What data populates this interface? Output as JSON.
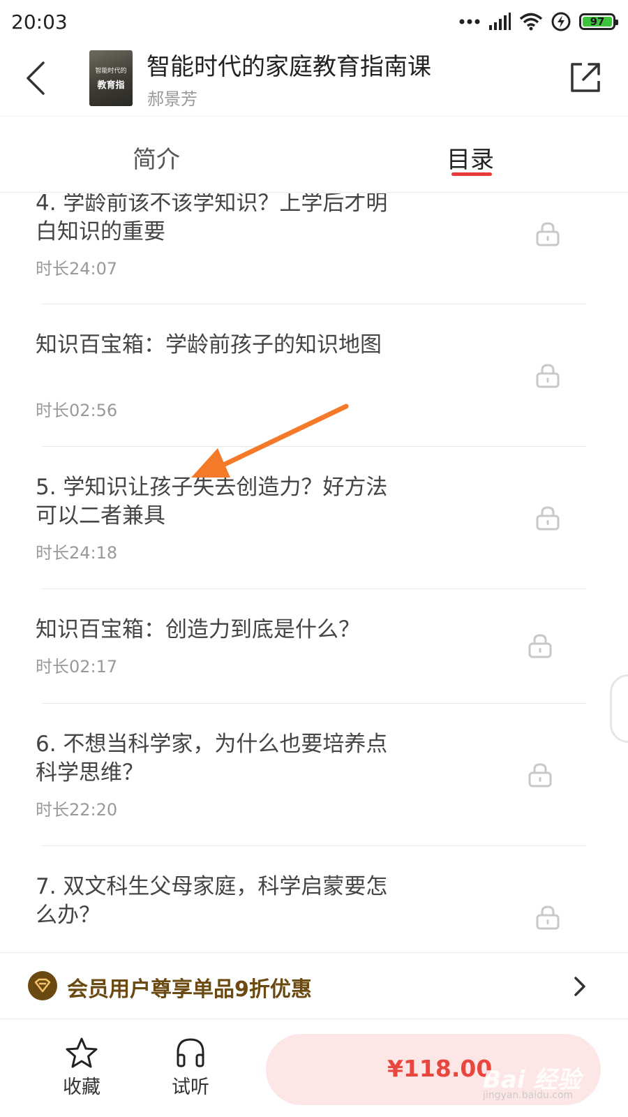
{
  "status_bar": {
    "time": "20:03",
    "battery": "97"
  },
  "header": {
    "cover_text_top": "智能时代的",
    "cover_text_bottom": "教育指",
    "title": "智能时代的家庭教育指南课",
    "author": "郝景芳"
  },
  "tabs": {
    "intro": "简介",
    "catalog": "目录",
    "active": "catalog"
  },
  "catalog": {
    "items": [
      {
        "title": "4. 学龄前该不该学知识？上学后才明白知识的重要",
        "duration": "时长24:07",
        "locked": true
      },
      {
        "title": "知识百宝箱：学龄前孩子的知识地图",
        "duration": "时长02:56",
        "locked": true
      },
      {
        "title": "5. 学知识让孩子失去创造力？好方法可以二者兼具",
        "duration": "时长24:18",
        "locked": true
      },
      {
        "title": "知识百宝箱：创造力到底是什么？",
        "duration": "时长02:17",
        "locked": true
      },
      {
        "title": "6. 不想当科学家，为什么也要培养点科学思维？",
        "duration": "时长22:20",
        "locked": true
      },
      {
        "title": "7. 双文科生父母家庭，科学启蒙要怎么办？",
        "duration": "",
        "locked": true
      }
    ]
  },
  "vip_bar": {
    "text": "会员用户尊享单品9折优惠"
  },
  "bottom_bar": {
    "favorite_label": "收藏",
    "listen_label": "试听",
    "price": "¥118.00"
  },
  "watermark": {
    "text": "Bai 经验",
    "sub": "jingyan.baidu.com"
  },
  "colors": {
    "accent_red": "#e83a3a",
    "price_red": "#e8463e",
    "buy_bg": "#fde6e6",
    "vip_brown": "#6b4a12",
    "annotation_orange": "#f47a2a"
  }
}
